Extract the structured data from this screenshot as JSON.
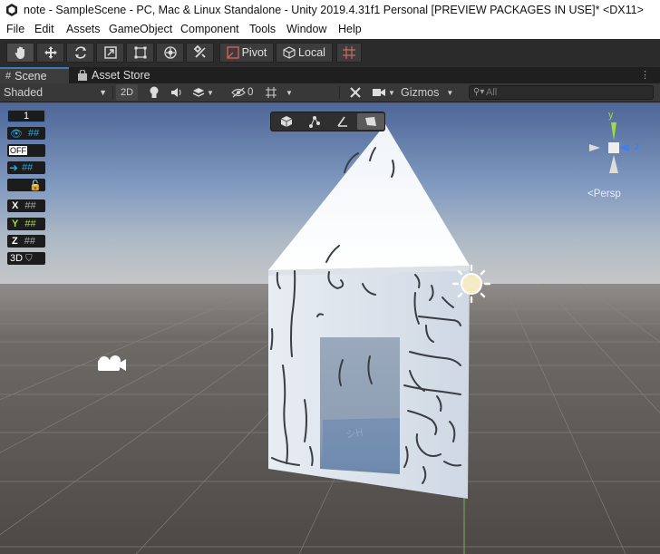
{
  "window": {
    "title": "note - SampleScene - PC, Mac & Linux Standalone - Unity 2019.4.31f1 Personal [PREVIEW PACKAGES IN USE]* <DX11>"
  },
  "menu": [
    "File",
    "Edit",
    "Assets",
    "GameObject",
    "Component",
    "Tools",
    "Window",
    "Help"
  ],
  "toolbar": {
    "pivot_label": "Pivot",
    "local_label": "Local"
  },
  "tabs": {
    "scene": "Scene",
    "asset_store": "Asset Store"
  },
  "scene_toolbar": {
    "shading_mode": "Shaded",
    "mode_2d": "2D",
    "hidden_count": "0",
    "gizmos_label": "Gizmos",
    "search_placeholder": "All"
  },
  "viewport_overlay": {
    "layer_value": "1",
    "off_label": "OFF",
    "axis_x": "X",
    "axis_y": "Y",
    "axis_z": "Z",
    "label_3d": "3D"
  },
  "gizmo": {
    "y_label": "y",
    "z_label": "z",
    "projection_label": "<Persp"
  },
  "colors": {
    "accent": "#3a79bb",
    "toolbar_bg": "#2b2b2b",
    "panel_bg": "#383838",
    "axis_y": "#9fdc3f",
    "axis_z": "#3b7ff0"
  }
}
